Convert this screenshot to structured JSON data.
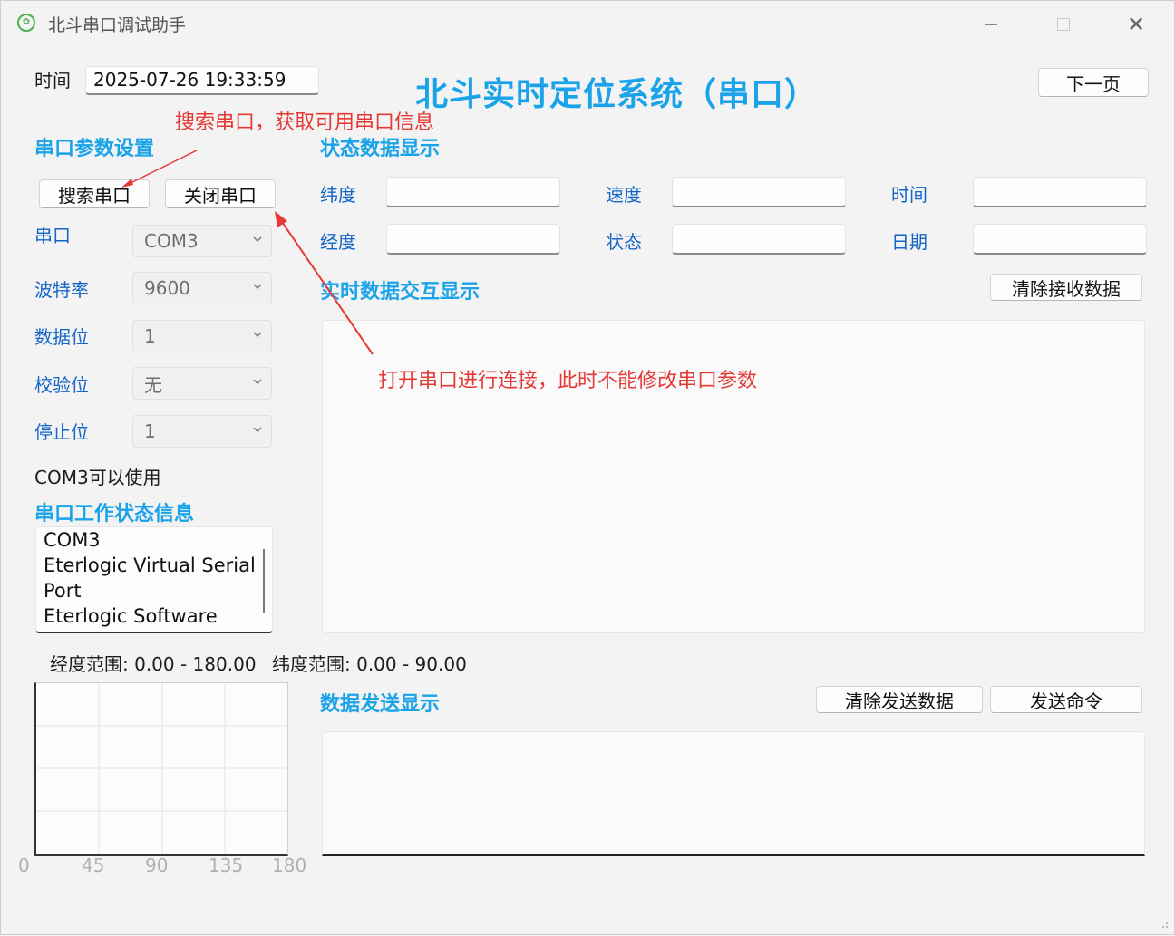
{
  "window": {
    "app_title": "北斗串口调试助手",
    "icon": "app-logo-icon",
    "controls": [
      "minimize-icon",
      "maximize-icon",
      "close-icon"
    ]
  },
  "header": {
    "time_label": "时间",
    "time_value": "2025-07-26 19:33:59",
    "main_title": "北斗实时定位系统（串口）",
    "next_page_button": "下一页"
  },
  "serial_settings": {
    "section_title": "串口参数设置",
    "search_button": "搜索串口",
    "close_button": "关闭串口",
    "fields": [
      {
        "label": "串口",
        "value": "COM3"
      },
      {
        "label": "波特率",
        "value": "9600"
      },
      {
        "label": "数据位",
        "value": "1"
      },
      {
        "label": "校验位",
        "value": "无"
      },
      {
        "label": "停止位",
        "value": "1"
      }
    ],
    "status_message": "COM3可以使用"
  },
  "serial_status_info": {
    "section_title": "串口工作状态信息",
    "lines": [
      "COM3",
      "Eterlogic Virtual Serial",
      "Port",
      "Eterlogic Software"
    ]
  },
  "range_info": {
    "longitude": "经度范围: 0.00 - 180.00",
    "latitude": "纬度范围: 0.00 - 90.00"
  },
  "plot": {
    "x_ticks": [
      "0",
      "45",
      "90",
      "135",
      "180"
    ]
  },
  "status_display": {
    "section_title": "状态数据显示",
    "fields": [
      {
        "label": "纬度",
        "value": ""
      },
      {
        "label": "速度",
        "value": ""
      },
      {
        "label": "时间",
        "value": ""
      },
      {
        "label": "经度",
        "value": ""
      },
      {
        "label": "状态",
        "value": ""
      },
      {
        "label": "日期",
        "value": ""
      }
    ]
  },
  "realtime_display": {
    "section_title": "实时数据交互显示",
    "clear_button": "清除接收数据",
    "content": ""
  },
  "send_display": {
    "section_title": "数据发送显示",
    "clear_button": "清除发送数据",
    "send_button": "发送命令",
    "content": ""
  },
  "annotations": {
    "search_note": "搜索串口，获取可用串口信息",
    "open_note": "打开串口进行连接，此时不能修改串口参数",
    "color": "#e53935"
  },
  "colors": {
    "section_blue": "#1aa3e8",
    "label_blue": "#1565c8"
  }
}
